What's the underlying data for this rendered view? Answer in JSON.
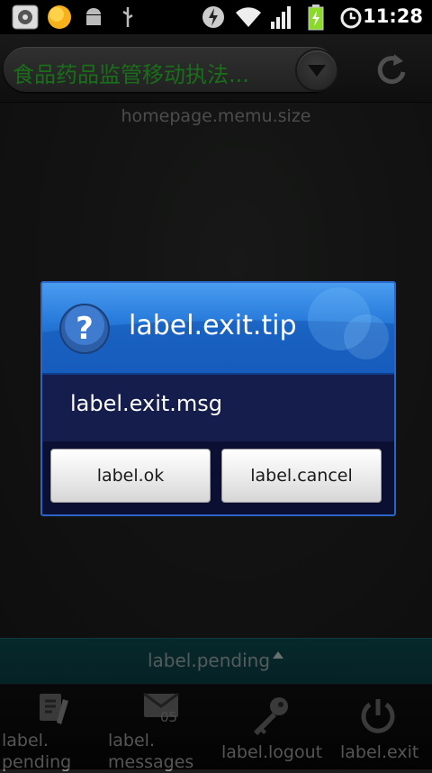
{
  "status_bar": {
    "time": "11:28",
    "icons": [
      "storage-icon",
      "sun-icon",
      "android-icon",
      "usb-icon",
      "lightning-icon",
      "wifi-icon",
      "signal-icon",
      "battery-charging-icon",
      "alarm-icon"
    ]
  },
  "title_bar": {
    "title": "食品药品监管移动执法...",
    "dropdown_icon": "chevron-down-icon",
    "refresh_icon": "refresh-icon"
  },
  "main": {
    "menu_size_label": "homepage.memu.size"
  },
  "pending_bar": {
    "label": "label.pending",
    "indicator_icon": "caret-up-icon"
  },
  "bottom_nav": {
    "items": [
      {
        "label": "label.\npending",
        "icon": "notes-icon"
      },
      {
        "label": "label.\nmessages",
        "icon": "mail-icon",
        "badge": "05"
      },
      {
        "label": "label.logout",
        "icon": "key-icon"
      },
      {
        "label": "label.exit",
        "icon": "power-icon"
      }
    ]
  },
  "dialog": {
    "title": "label.exit.tip",
    "icon": "question-icon",
    "message": "label.exit.msg",
    "ok_label": "label.ok",
    "cancel_label": "label.cancel"
  },
  "colors": {
    "title_text": "#2fc92f",
    "dialog_header": "#2679d9",
    "dialog_body": "#141d4c",
    "pending_bar": "#0c4a4f"
  }
}
